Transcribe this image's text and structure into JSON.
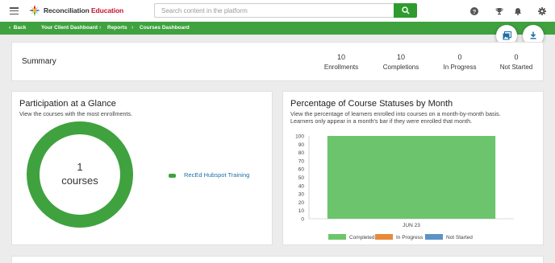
{
  "header": {
    "brand_main": "Reconciliation",
    "brand_accent": "Education",
    "search_placeholder": "Search content in the platform",
    "icons": [
      "menu-icon",
      "search-icon",
      "help-icon",
      "trophy-icon",
      "bell-icon",
      "gear-icon"
    ]
  },
  "nav": {
    "back": "Back",
    "breadcrumbs": [
      "Your Client Dashboard",
      "Reports",
      "Courses Dashboard"
    ]
  },
  "summary": {
    "title": "Summary",
    "stats": [
      {
        "value": "10",
        "label": "Enrollments"
      },
      {
        "value": "10",
        "label": "Completions"
      },
      {
        "value": "0",
        "label": "In Progress"
      },
      {
        "value": "0",
        "label": "Not Started"
      }
    ]
  },
  "participation": {
    "title": "Participation at a Glance",
    "subtitle": "View the courses with the most enrollments.",
    "center_value": "1",
    "center_unit": "courses",
    "legend": [
      {
        "label": "RecEd Hubspot Training",
        "color": "#3fa23f"
      }
    ]
  },
  "status_chart": {
    "title": "Percentage of Course Statuses by Month",
    "subtitle_line1": "View the percentage of learners enrolled into courses on a month-by-month basis.",
    "subtitle_line2": "Learners only appear in a month's bar if they were enrolled that month."
  },
  "chart_data": {
    "type": "bar",
    "stacked": true,
    "categories": [
      "JUN 23"
    ],
    "series": [
      {
        "name": "Completed",
        "values": [
          100
        ],
        "color": "#6cc56c"
      },
      {
        "name": "In Progress",
        "values": [
          0
        ],
        "color": "#e8893a"
      },
      {
        "name": "Not Started",
        "values": [
          0
        ],
        "color": "#5b93c7"
      }
    ],
    "yticks": [
      "100",
      "90",
      "80",
      "70",
      "60",
      "50",
      "40",
      "30",
      "20",
      "10",
      "0"
    ],
    "ylim": [
      0,
      100
    ],
    "legend_position": "bottom"
  },
  "colors": {
    "brand_green": "#3fa23f",
    "bar_green": "#6cc56c",
    "brand_red": "#c8102e",
    "link_blue": "#1d6fa5"
  }
}
